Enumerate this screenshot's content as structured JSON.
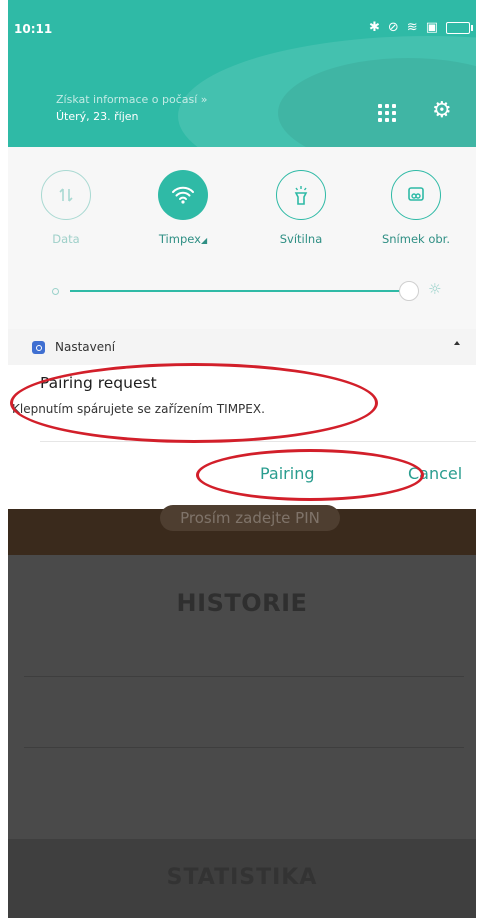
{
  "status_bar": {
    "time": "10:11",
    "icons": [
      "bluetooth-icon",
      "alarm-icon",
      "wifi-icon",
      "sim-icon",
      "battery-icon"
    ]
  },
  "header": {
    "weather_link": "Získat informace o počasí »",
    "date": "Úterý, 23. říjen"
  },
  "quick_settings": {
    "tiles": [
      {
        "label": "Data",
        "icon": "data-arrows-icon",
        "active": false
      },
      {
        "label": "Timpex",
        "icon": "wifi-icon",
        "active": true
      },
      {
        "label": "Svítilna",
        "icon": "flashlight-icon",
        "active": false
      },
      {
        "label": "Snímek obr.",
        "icon": "screenshot-icon",
        "active": false
      }
    ],
    "brightness_level": 0.95
  },
  "notification": {
    "app_name": "Nastavení",
    "title": "Pairing request",
    "text": "Klepnutím spárujete se zařízením TIMPEX.",
    "action_primary": "Pairing",
    "action_secondary": "Cancel"
  },
  "app": {
    "pin_prompt": "Prosím zadejte PIN",
    "historie": "HISTORIE",
    "statistika": "STATISTIKA"
  },
  "colors": {
    "accent": "#2fbaa6",
    "annotation": "#d21f2a"
  }
}
